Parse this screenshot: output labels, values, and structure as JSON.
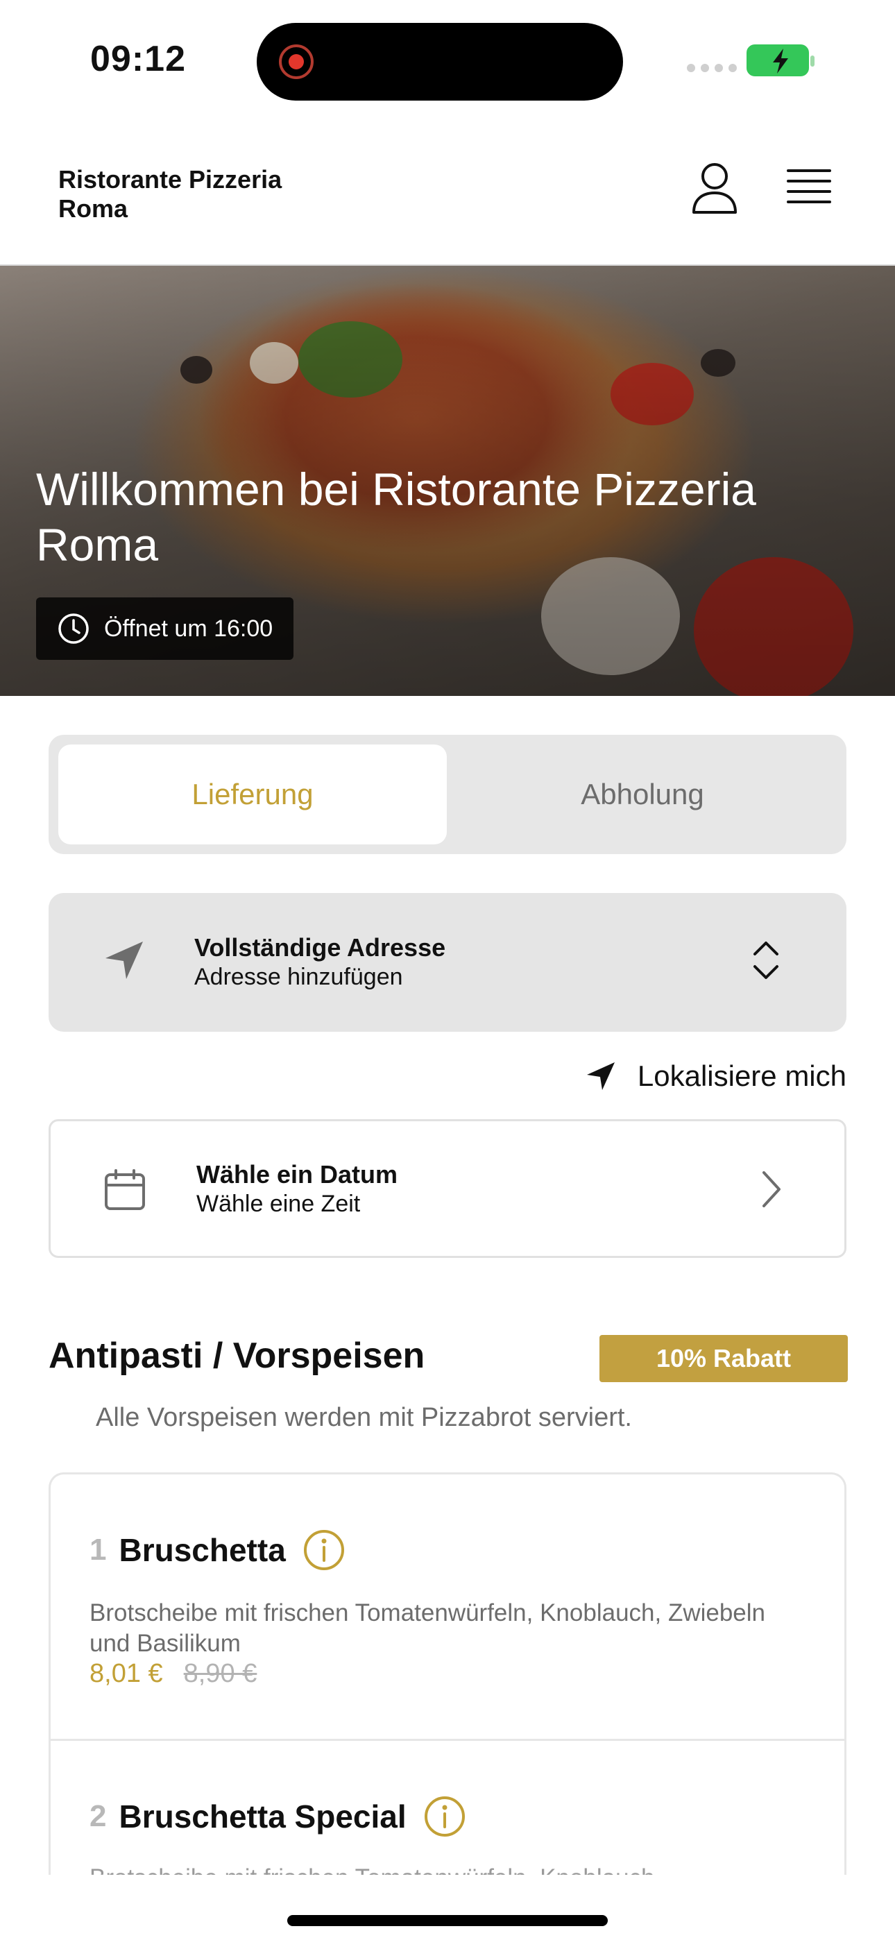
{
  "status_bar": {
    "time": "09:12"
  },
  "header": {
    "restaurant_name": "Ristorante Pizzeria Roma"
  },
  "hero": {
    "title": "Willkommen bei Ristorante Pizzeria Roma",
    "opens_text": "Öffnet um 16:00"
  },
  "mode_tabs": {
    "delivery": "Lieferung",
    "pickup": "Abholung",
    "selected": "Lieferung"
  },
  "address": {
    "title": "Vollständige Adresse",
    "subtitle": "Adresse hinzufügen"
  },
  "locate_label": "Lokalisiere mich",
  "schedule": {
    "title": "Wähle ein Datum",
    "subtitle": "Wähle eine Zeit"
  },
  "category": {
    "title": "Antipasti / Vorspeisen",
    "badge": "10% Rabatt",
    "note": "Alle Vorspeisen werden mit Pizzabrot serviert."
  },
  "items": [
    {
      "number": "1",
      "name": "Bruschetta",
      "description": "Brotscheibe mit frischen Tomatenwürfeln, Knoblauch, Zwiebeln und Basilikum",
      "price_new": "8,01 €",
      "price_old": "8,90 €"
    },
    {
      "number": "2",
      "name": "Bruschetta Special",
      "description": "Brotscheibe mit frischen Tomatenwürfeln, Knoblauch,"
    }
  ],
  "colors": {
    "accent": "#c2a036",
    "badge_bg": "#c2a040",
    "battery": "#34c759"
  },
  "icons": [
    "user-icon",
    "menu-icon",
    "clock-icon",
    "navigation-arrow-icon",
    "chevron-up-down-icon",
    "location-arrow-icon",
    "calendar-icon",
    "chevron-right-icon",
    "info-icon"
  ]
}
